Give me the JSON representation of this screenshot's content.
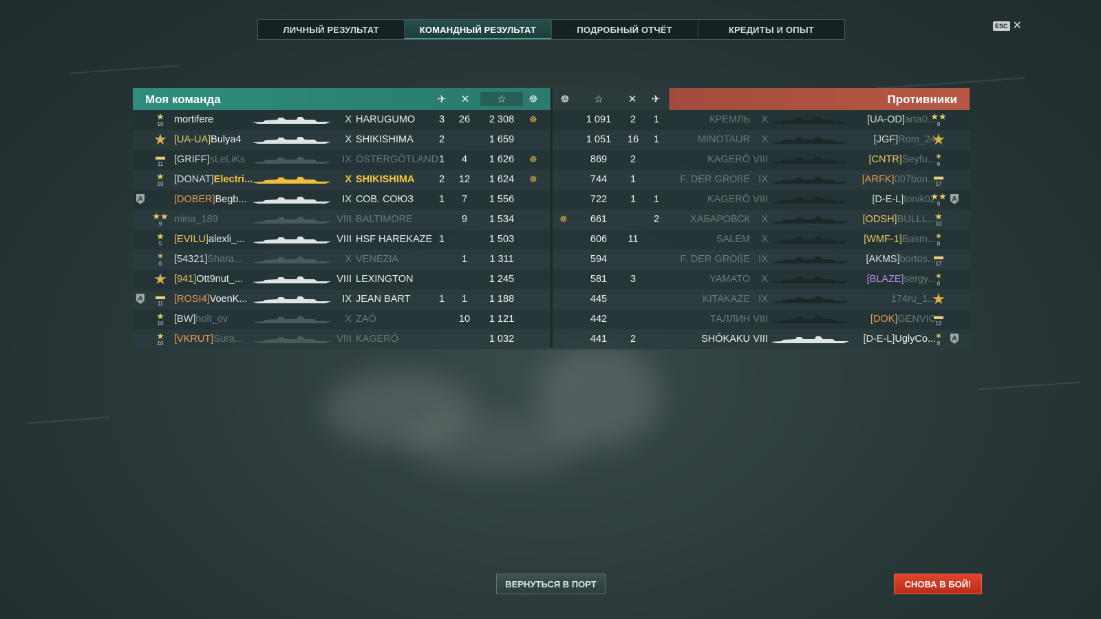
{
  "tabs": [
    {
      "label": "ЛИЧНЫЙ РЕЗУЛЬТАТ",
      "active": false
    },
    {
      "label": "КОМАНДНЫЙ РЕЗУЛЬТАТ",
      "active": true
    },
    {
      "label": "ПОДРОБНЫЙ ОТЧЁТ",
      "active": false
    },
    {
      "label": "КРЕДИТЫ И ОПЫТ",
      "active": false
    }
  ],
  "close": {
    "key_label": "ESC",
    "icon": "close-icon"
  },
  "my_team": {
    "title": "Моя команда",
    "header_icons": [
      "planes-shot-icon",
      "kills-icon",
      "xp-star-icon",
      "base-capture-icon"
    ],
    "players": [
      {
        "rank": "★",
        "rank_level": "10",
        "rank_style": "small",
        "premium": false,
        "clan": "",
        "clan_color": "",
        "nick": "mortifere",
        "tier": "X",
        "ship": "HARUGUMO",
        "planes": "3",
        "kills_or_frags": "26",
        "xp": "2 308",
        "cap": true,
        "dim": false,
        "self": false
      },
      {
        "rank": "★",
        "rank_level": "",
        "rank_style": "big",
        "premium": false,
        "clan": "[UA-UA]",
        "clan_color": "yellow",
        "nick": "Bulya4",
        "tier": "X",
        "ship": "SHIKISHIMA",
        "planes": "2",
        "kills_or_frags": "",
        "xp": "1 659",
        "cap": false,
        "dim": false,
        "self": false
      },
      {
        "rank": "▬",
        "rank_level": "11",
        "rank_style": "stripe",
        "premium": false,
        "clan": "[GRIFF]",
        "clan_color": "",
        "nick": "sLeLiKs",
        "tier": "IX",
        "ship": "ÖSTERGÖTLAND",
        "planes": "1",
        "kills_or_frags": "4",
        "xp": "1 626",
        "cap": true,
        "dim": true,
        "self": false
      },
      {
        "rank": "★",
        "rank_level": "10",
        "rank_style": "small",
        "premium": false,
        "clan": "[DONAT]",
        "clan_color": "",
        "nick": "Electri...",
        "tier": "X",
        "ship": "SHIKISHIMA",
        "planes": "2",
        "kills_or_frags": "12",
        "xp": "1 624",
        "cap": true,
        "dim": false,
        "self": true
      },
      {
        "rank": "",
        "rank_level": "",
        "rank_style": "",
        "premium": true,
        "clan": "[DOBER]",
        "clan_color": "orange",
        "nick": "Begb...",
        "tier": "IX",
        "ship": "СОВ. СОЮЗ",
        "planes": "1",
        "kills_or_frags": "7",
        "xp": "1 556",
        "cap": false,
        "dim": false,
        "self": false
      },
      {
        "rank": "★★",
        "rank_level": "9",
        "rank_style": "small",
        "premium": false,
        "clan": "",
        "clan_color": "",
        "nick": "mina_189",
        "tier": "VIII",
        "ship": "BALTIMORE",
        "planes": "",
        "kills_or_frags": "9",
        "xp": "1 534",
        "cap": false,
        "dim": true,
        "self": false
      },
      {
        "rank": "★",
        "rank_level": "5",
        "rank_style": "small",
        "premium": false,
        "clan": "[EVILU]",
        "clan_color": "yellow",
        "nick": "alexli_...",
        "tier": "VIII",
        "ship": "HSF HAREKAZE",
        "planes": "1",
        "kills_or_frags": "",
        "xp": "1 503",
        "cap": false,
        "dim": false,
        "self": false
      },
      {
        "rank": "✶",
        "rank_level": "6",
        "rank_style": "small",
        "premium": false,
        "clan": "[54321]",
        "clan_color": "",
        "nick": "Shara...",
        "tier": "X",
        "ship": "VENEZIA",
        "planes": "",
        "kills_or_frags": "1",
        "xp": "1 311",
        "cap": false,
        "dim": true,
        "self": false
      },
      {
        "rank": "★",
        "rank_level": "",
        "rank_style": "big",
        "premium": false,
        "clan": "[941]",
        "clan_color": "yellow",
        "nick": "Ott9nut_...",
        "tier": "VIII",
        "ship": "LEXINGTON",
        "planes": "",
        "kills_or_frags": "",
        "xp": "1 245",
        "cap": false,
        "dim": false,
        "self": false
      },
      {
        "rank": "▬",
        "rank_level": "11",
        "rank_style": "stripe",
        "premium": true,
        "clan": "[ROSI4]",
        "clan_color": "orange",
        "nick": "VoenK...",
        "tier": "IX",
        "ship": "JEAN BART",
        "planes": "1",
        "kills_or_frags": "1",
        "xp": "1 188",
        "cap": false,
        "dim": false,
        "self": false
      },
      {
        "rank": "★",
        "rank_level": "10",
        "rank_style": "small",
        "premium": false,
        "clan": "[BW]",
        "clan_color": "",
        "nick": "holt_ov",
        "tier": "X",
        "ship": "ZAŌ",
        "planes": "",
        "kills_or_frags": "10",
        "xp": "1 121",
        "cap": false,
        "dim": true,
        "self": false
      },
      {
        "rank": "★",
        "rank_level": "10",
        "rank_style": "small",
        "premium": false,
        "clan": "[VKRUT]",
        "clan_color": "orange",
        "nick": "Sura...",
        "tier": "VIII",
        "ship": "KAGERŌ",
        "planes": "",
        "kills_or_frags": "",
        "xp": "1 032",
        "cap": false,
        "dim": true,
        "self": false
      }
    ]
  },
  "enemy_team": {
    "title": "Противники",
    "header_icons": [
      "base-capture-icon",
      "xp-star-icon",
      "kills-icon",
      "planes-shot-icon"
    ],
    "players": [
      {
        "cap": false,
        "xp": "1 091",
        "kills_or_frags": "2",
        "planes": "1",
        "ship": "КРЕМЛЬ",
        "tier": "X",
        "clan": "[UA-OD]",
        "clan_color": "",
        "nick": "arta0...",
        "rank": "★★",
        "rank_level": "9",
        "rank_style": "small",
        "premium": false,
        "dim": true
      },
      {
        "cap": false,
        "xp": "1 051",
        "kills_or_frags": "16",
        "planes": "1",
        "ship": "MINOTAUR",
        "tier": "X",
        "clan": "[JGF]",
        "clan_color": "",
        "nick": "Rom_24",
        "rank": "★",
        "rank_level": "",
        "rank_style": "big",
        "premium": false,
        "dim": true
      },
      {
        "cap": false,
        "xp": "869",
        "kills_or_frags": "2",
        "planes": "",
        "ship": "KAGERŌ",
        "tier": "VIII",
        "clan": "[CNTR]",
        "clan_color": "yellow",
        "nick": "Seyfu...",
        "rank": "✶",
        "rank_level": "6",
        "rank_style": "small",
        "premium": false,
        "dim": true
      },
      {
        "cap": false,
        "xp": "744",
        "kills_or_frags": "1",
        "planes": "",
        "ship": "F. DER GROßE",
        "tier": "IX",
        "clan": "[ARFK]",
        "clan_color": "orange",
        "nick": "007bon...",
        "rank": "▬",
        "rank_level": "17",
        "rank_style": "stripe",
        "premium": false,
        "dim": true
      },
      {
        "cap": false,
        "xp": "722",
        "kills_or_frags": "1",
        "planes": "1",
        "ship": "KAGERŌ",
        "tier": "VIII",
        "clan": "[D-E-L]",
        "clan_color": "",
        "nick": "tonik02",
        "rank": "★★",
        "rank_level": "9",
        "rank_style": "small",
        "premium": true,
        "dim": true
      },
      {
        "cap": true,
        "xp": "661",
        "kills_or_frags": "",
        "planes": "2",
        "ship": "ХАБАРОВСК",
        "tier": "X",
        "clan": "[ODSH]",
        "clan_color": "yellow",
        "nick": "BULLL...",
        "rank": "★",
        "rank_level": "10",
        "rank_style": "small",
        "premium": false,
        "dim": true
      },
      {
        "cap": false,
        "xp": "606",
        "kills_or_frags": "11",
        "planes": "",
        "ship": "SALEM",
        "tier": "X",
        "clan": "[WMF-1]",
        "clan_color": "yellow",
        "nick": "Basm...",
        "rank": "✶",
        "rank_level": "8",
        "rank_style": "small",
        "premium": false,
        "dim": true
      },
      {
        "cap": false,
        "xp": "594",
        "kills_or_frags": "",
        "planes": "",
        "ship": "F. DER GROßE",
        "tier": "IX",
        "clan": "[AKMS]",
        "clan_color": "",
        "nick": "bortos...",
        "rank": "▬",
        "rank_level": "17",
        "rank_style": "stripe",
        "premium": false,
        "dim": true
      },
      {
        "cap": false,
        "xp": "581",
        "kills_or_frags": "3",
        "planes": "",
        "ship": "YAMATO",
        "tier": "X",
        "clan": "[BLAZE]",
        "clan_color": "purple",
        "nick": "sergy...",
        "rank": "✶",
        "rank_level": "6",
        "rank_style": "small",
        "premium": false,
        "dim": true
      },
      {
        "cap": false,
        "xp": "445",
        "kills_or_frags": "",
        "planes": "",
        "ship": "KITAKAZE",
        "tier": "IX",
        "clan": "",
        "clan_color": "",
        "nick": "174ru_1...",
        "rank": "★",
        "rank_level": "",
        "rank_style": "big",
        "premium": false,
        "dim": true
      },
      {
        "cap": false,
        "xp": "442",
        "kills_or_frags": "",
        "planes": "",
        "ship": "ТАЛЛИН",
        "tier": "VIII",
        "clan": "[DOK]",
        "clan_color": "orange",
        "nick": "GENVIC",
        "rank": "▬",
        "rank_level": "12",
        "rank_style": "stripe",
        "premium": false,
        "dim": true
      },
      {
        "cap": false,
        "xp": "441",
        "kills_or_frags": "2",
        "planes": "",
        "ship": "SHŌKAKU",
        "tier": "VIII",
        "clan": "[D-E-L]",
        "clan_color": "",
        "nick": "UglyCo...",
        "rank": "✶",
        "rank_level": "8",
        "rank_style": "small",
        "premium": true,
        "dim": false
      }
    ]
  },
  "buttons": {
    "return_port": "ВЕРНУТЬСЯ В ПОРТ",
    "battle_again": "СНОВА В БОЙ!"
  },
  "colors": {
    "my_team_header": "#2f8d7d",
    "enemy_header": "#b65844",
    "self_highlight": "#f5c842",
    "battle_button": "#e2442a"
  }
}
